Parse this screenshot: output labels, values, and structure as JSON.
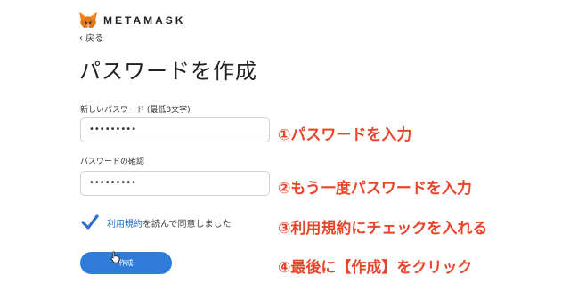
{
  "header": {
    "logo_text": "METAMASK",
    "logo_icon": "fox-icon",
    "back_label": "‹ 戻る"
  },
  "page": {
    "title": "パスワードを作成"
  },
  "form": {
    "new_password_label": "新しいパスワード (最低8文字)",
    "new_password_value": "•••••••••",
    "confirm_password_label": "パスワードの確認",
    "confirm_password_value": "•••••••••",
    "terms_checked": true,
    "terms_link": "利用規約",
    "terms_text": "を読んで同意しました",
    "create_button_label": "作成"
  },
  "annotations": {
    "step1": "①パスワードを入力",
    "step2": "②もう一度パスワードを入力",
    "step3": "③利用規約にチェックを入れる",
    "step4": "④最後に【作成】をクリック",
    "color": "#e8452c"
  },
  "colors": {
    "accent": "#2f7bd8",
    "checkbox": "#2f6fd0"
  }
}
